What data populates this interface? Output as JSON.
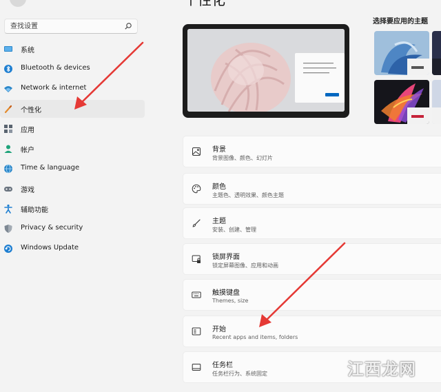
{
  "page": {
    "title": "个性化"
  },
  "search": {
    "placeholder": "查找设置"
  },
  "sidebar": {
    "items": [
      {
        "label": "系统",
        "icon": "monitor-icon"
      },
      {
        "label": "Bluetooth & devices",
        "icon": "bluetooth-icon"
      },
      {
        "label": "Network & internet",
        "icon": "wifi-icon"
      },
      {
        "label": "个性化",
        "icon": "pen-icon",
        "selected": true
      },
      {
        "label": "应用",
        "icon": "apps-icon"
      },
      {
        "label": "帐户",
        "icon": "person-icon"
      },
      {
        "label": "Time & language",
        "icon": "globe-clock-icon"
      },
      {
        "label": "游戏",
        "icon": "gamepad-icon"
      },
      {
        "label": "辅助功能",
        "icon": "accessibility-icon"
      },
      {
        "label": "Privacy & security",
        "icon": "shield-icon"
      },
      {
        "label": "Windows Update",
        "icon": "update-icon"
      }
    ]
  },
  "themes": {
    "label": "选择要应用的主题"
  },
  "cards": [
    {
      "title": "背景",
      "subtitle": "背景图像、颜色、幻灯片",
      "icon": "image-icon"
    },
    {
      "title": "颜色",
      "subtitle": "主题色、透明效果、颜色主题",
      "icon": "palette-icon"
    },
    {
      "title": "主题",
      "subtitle": "安装、创建、管理",
      "icon": "brush-icon"
    },
    {
      "title": "锁屏界面",
      "subtitle": "锁定屏幕图像、应用和动画",
      "icon": "lock-screen-icon"
    },
    {
      "title": "触摸键盘",
      "subtitle": "Themes, size",
      "icon": "keyboard-icon"
    },
    {
      "title": "开始",
      "subtitle": "Recent apps and items, folders",
      "icon": "start-menu-icon"
    },
    {
      "title": "任务栏",
      "subtitle": "任务栏行为、系统固定",
      "icon": "taskbar-icon"
    }
  ],
  "watermark": {
    "text": "江西龙网"
  },
  "colors": {
    "accent": "#0067c0",
    "annotation_arrow": "#e53935"
  }
}
